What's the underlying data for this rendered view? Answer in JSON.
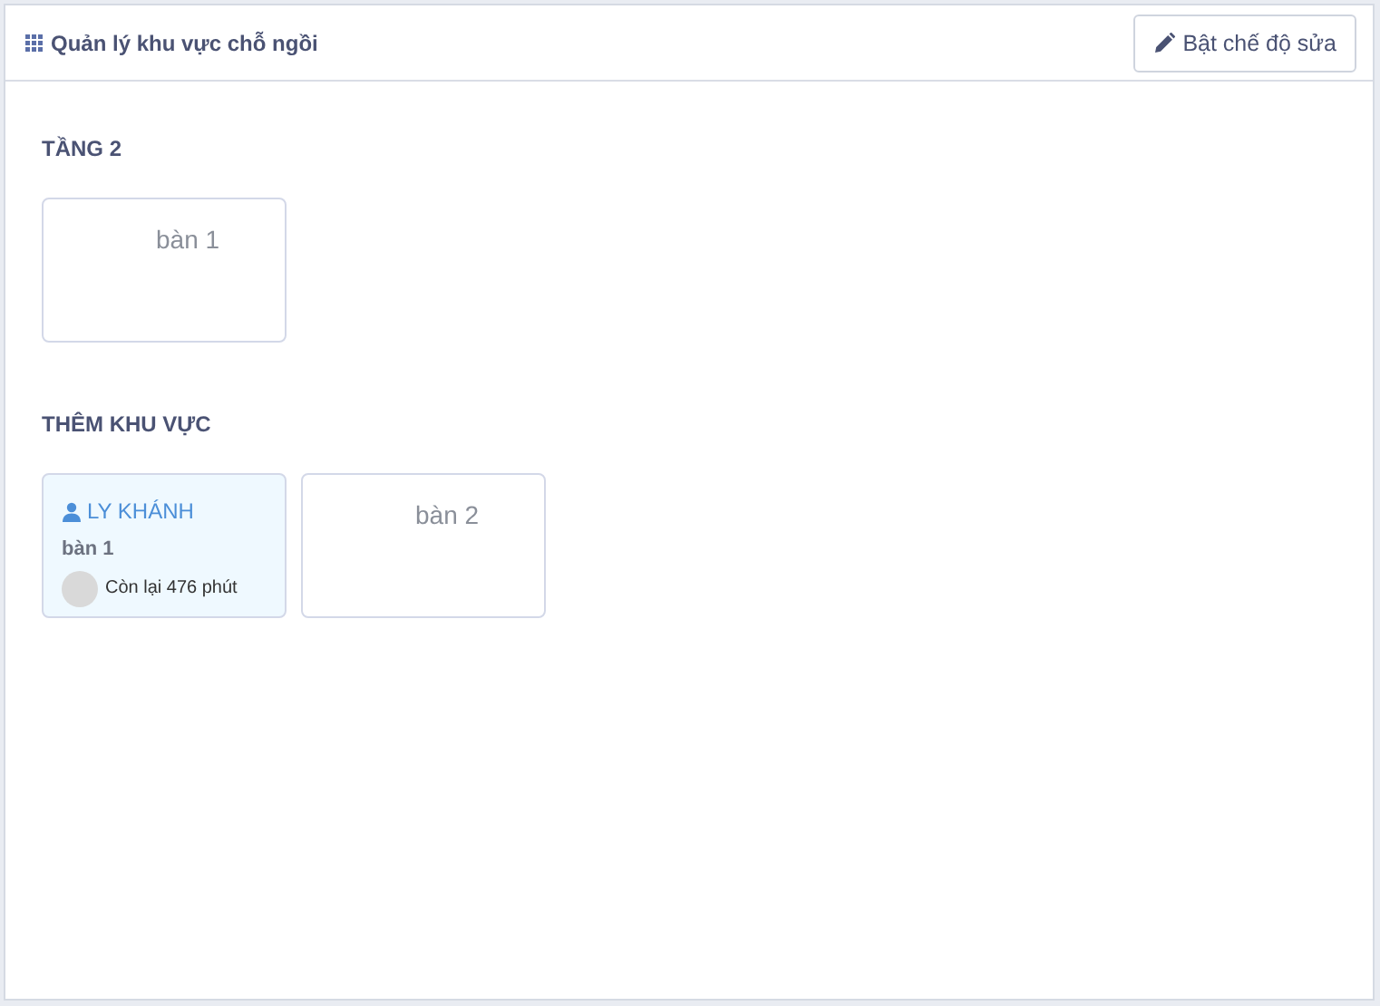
{
  "header": {
    "title": "Quản lý khu vực chỗ ngồi",
    "edit_button": "Bật chế độ sửa"
  },
  "areas": [
    {
      "name": "TẦNG 2",
      "tables": [
        {
          "kind": "empty",
          "name": "bàn 1"
        }
      ]
    },
    {
      "name": "THÊM KHU VỰC",
      "tables": [
        {
          "kind": "occupied",
          "customer": "LY KHÁNH",
          "name": "bàn 1",
          "remaining": "Còn lại 476 phút"
        },
        {
          "kind": "empty",
          "name": "bàn 2"
        }
      ]
    }
  ]
}
